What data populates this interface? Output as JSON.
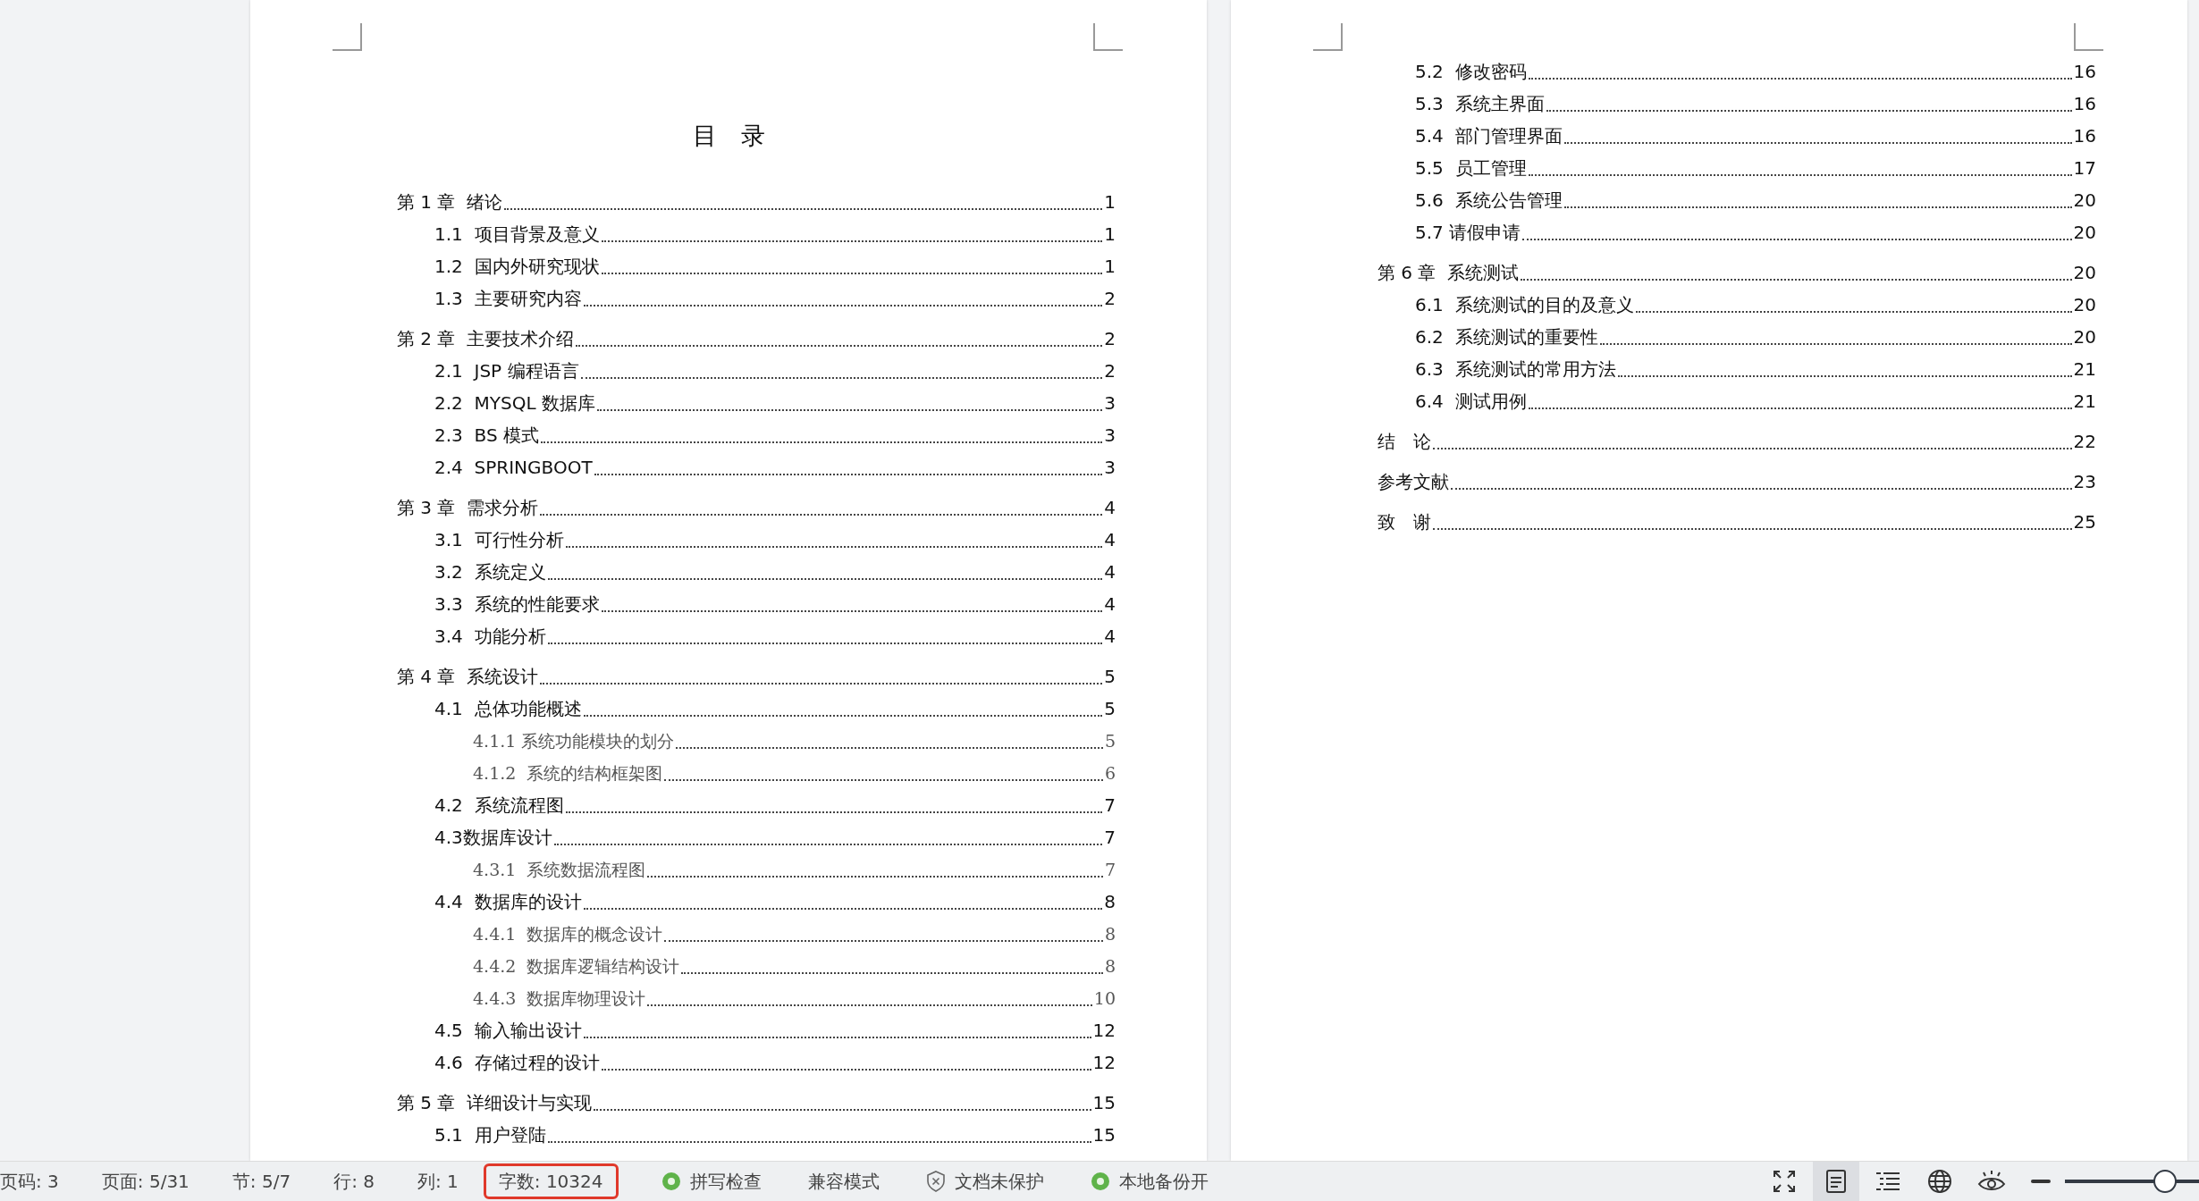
{
  "pages": [
    {
      "title": "目　录",
      "entries": [
        {
          "text": "第 1 章  绪论",
          "page": "1",
          "children": [
            {
              "text": "1.1  项目背景及意义",
              "page": "1"
            },
            {
              "text": "1.2  国内外研究现状",
              "page": "1"
            },
            {
              "text": "1.3  主要研究内容",
              "page": "2"
            }
          ]
        },
        {
          "text": "第 2 章  主要技术介绍",
          "page": "2",
          "children": [
            {
              "text": "2.1  JSP 编程语言",
              "page": "2"
            },
            {
              "text": "2.2  MYSQL 数据库",
              "page": "3"
            },
            {
              "text": "2.3  BS 模式",
              "page": "3"
            },
            {
              "text": "2.4  SPRINGBOOT",
              "page": "3"
            }
          ]
        },
        {
          "text": "第 3 章  需求分析",
          "page": "4",
          "children": [
            {
              "text": "3.1  可行性分析",
              "page": "4"
            },
            {
              "text": "3.2  系统定义",
              "page": "4"
            },
            {
              "text": "3.3  系统的性能要求",
              "page": "4"
            },
            {
              "text": "3.4  功能分析",
              "page": "4"
            }
          ]
        },
        {
          "text": "第 4 章  系统设计",
          "page": "5",
          "children": [
            {
              "text": "4.1  总体功能概述",
              "page": "5",
              "children": [
                {
                  "text": "4.1.1 系统功能模块的划分",
                  "page": "5"
                },
                {
                  "text": "4.1.2  系统的结构框架图",
                  "page": "6"
                }
              ]
            },
            {
              "text": "4.2  系统流程图",
              "page": "7"
            },
            {
              "text": "4.3数据库设计",
              "page": "7",
              "children": [
                {
                  "text": "4.3.1  系统数据流程图",
                  "page": "7"
                }
              ]
            },
            {
              "text": "4.4  数据库的设计",
              "page": "8",
              "children": [
                {
                  "text": "4.4.1  数据库的概念设计",
                  "page": "8"
                },
                {
                  "text": "4.4.2  数据库逻辑结构设计",
                  "page": "8"
                },
                {
                  "text": "4.4.3  数据库物理设计",
                  "page": "10"
                }
              ]
            },
            {
              "text": "4.5  输入输出设计",
              "page": "12"
            },
            {
              "text": "4.6  存储过程的设计",
              "page": "12"
            }
          ]
        },
        {
          "text": "第 5 章  详细设计与实现",
          "page": "15",
          "children": [
            {
              "text": "5.1  用户登陆",
              "page": "15"
            }
          ]
        }
      ]
    },
    {
      "entries": [
        {
          "children": [
            {
              "text": "5.2  修改密码",
              "page": "16"
            },
            {
              "text": "5.3  系统主界面",
              "page": "16"
            },
            {
              "text": "5.4  部门管理界面",
              "page": "16"
            },
            {
              "text": "5.5  员工管理",
              "page": "17"
            },
            {
              "text": "5.6  系统公告管理",
              "page": "20"
            },
            {
              "text": "5.7 请假申请",
              "page": "20"
            }
          ]
        },
        {
          "text": "第 6 章  系统测试",
          "page": "20",
          "children": [
            {
              "text": "6.1  系统测试的目的及意义",
              "page": "20"
            },
            {
              "text": "6.2  系统测试的重要性",
              "page": "20"
            },
            {
              "text": "6.3  系统测试的常用方法",
              "page": "21"
            },
            {
              "text": "6.4  测试用例",
              "page": "21"
            }
          ]
        },
        {
          "text": "结　论",
          "page": "22"
        },
        {
          "text": "参考文献",
          "page": "23"
        },
        {
          "text": "致　谢",
          "page": "25"
        }
      ]
    }
  ],
  "status_bar": {
    "fields": [
      {
        "label": "页码: 3",
        "highlighted": false
      },
      {
        "label": "页面: 5/31",
        "highlighted": false
      },
      {
        "label": "节: 5/7",
        "highlighted": false
      },
      {
        "label": "行: 8",
        "highlighted": false
      },
      {
        "label": "列: 1",
        "highlighted": false
      },
      {
        "label": "字数: 10324",
        "highlighted": true
      }
    ],
    "indicators": [
      {
        "kind": "dot",
        "label": "拼写检查"
      },
      {
        "kind": "plain",
        "label": "兼容模式"
      },
      {
        "kind": "shield",
        "label": "文档未保护"
      },
      {
        "kind": "dot",
        "label": "本地备份开"
      }
    ],
    "views": [
      {
        "kind": "fullscreen",
        "selected": false
      },
      {
        "kind": "page",
        "selected": true
      },
      {
        "kind": "outline",
        "selected": false
      },
      {
        "kind": "web",
        "selected": false
      },
      {
        "kind": "eye",
        "selected": false
      }
    ],
    "zoom": {
      "level": 0.8
    }
  }
}
